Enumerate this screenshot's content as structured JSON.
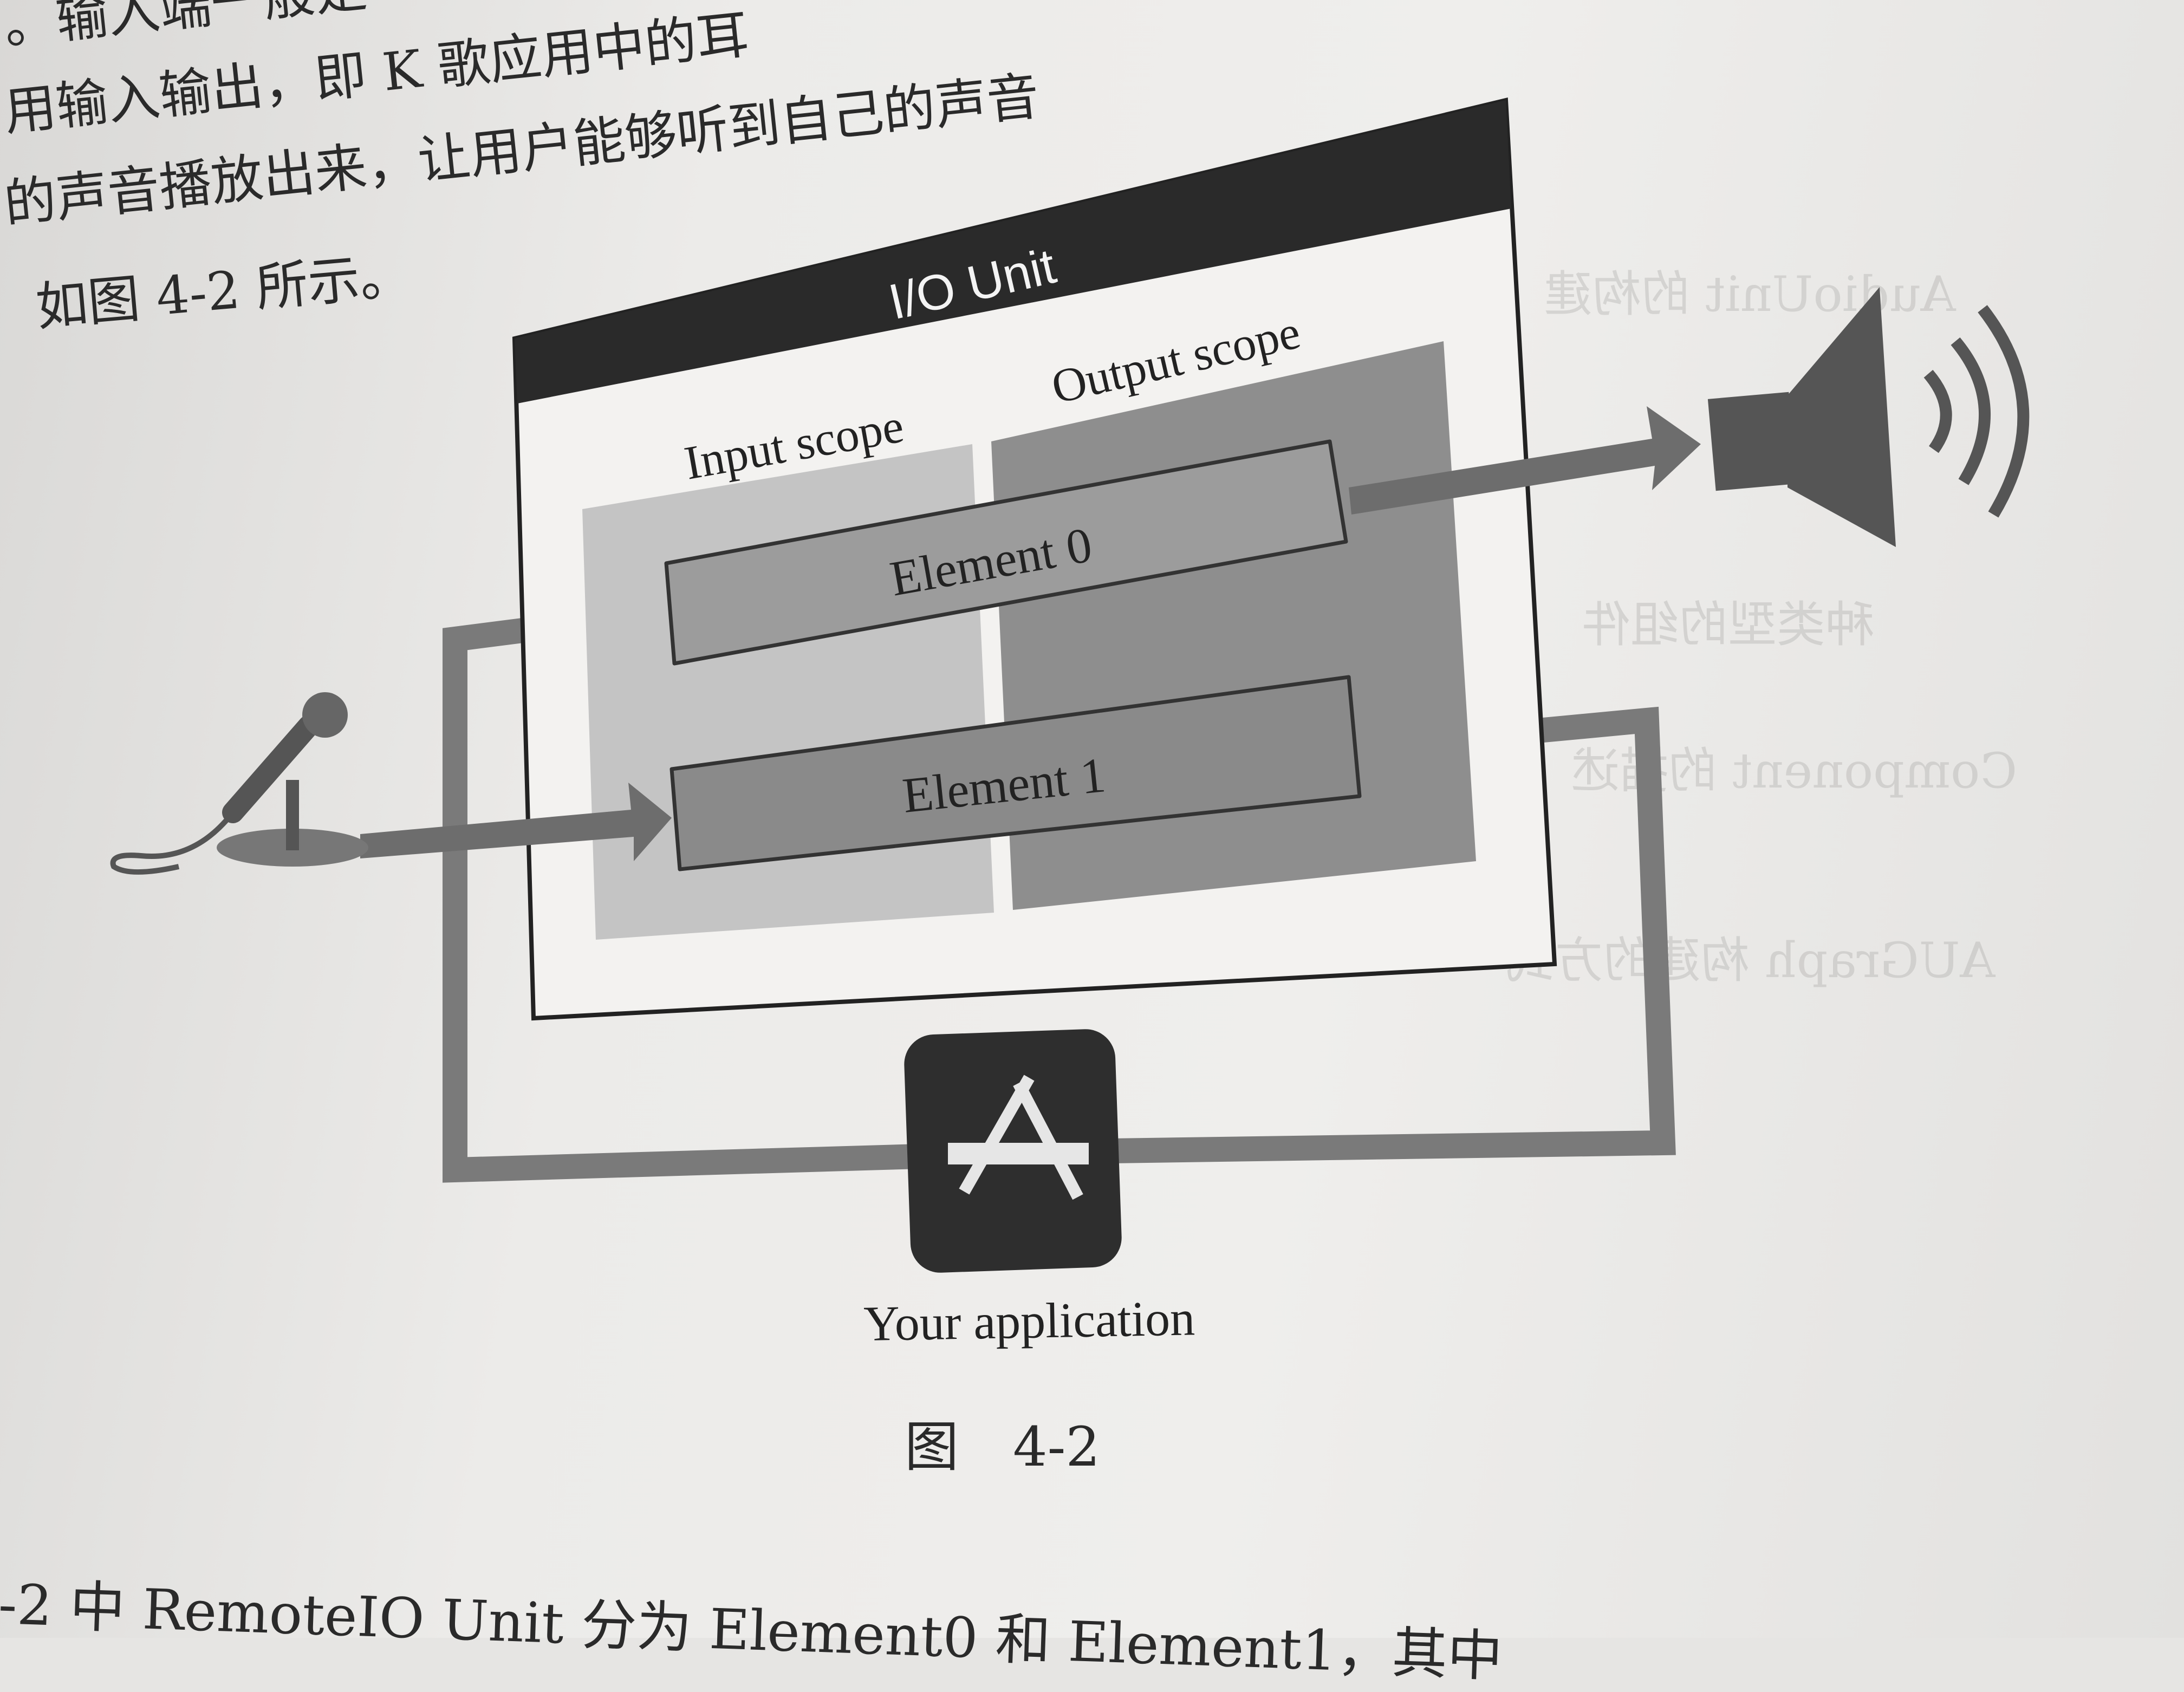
{
  "page": {
    "top_lines": [
      "。输入端一般是",
      "用输入输出，即 K 歌应用中的耳",
      "的声音播放出来，让用户能够听到自己的声音",
      "如图 4-2 所示。"
    ],
    "bottom_line": "-2 中 RemoteIO Unit 分为 Element0 和 Element1，其中",
    "caption": "图　4-2"
  },
  "diagram": {
    "unit_title": "I/O Unit",
    "input_scope": "Input scope",
    "output_scope": "Output scope",
    "element0": "Element 0",
    "element1": "Element 1",
    "app_label": "Your application",
    "icons": [
      "microphone-icon",
      "speaker-icon",
      "sound-waves-icon",
      "app-store-icon"
    ]
  },
  "ghost_text": [
    "AudioUnit 的构建",
    "AUGraph 构建的方式",
    "Component 的描述",
    "种类型的组件"
  ]
}
